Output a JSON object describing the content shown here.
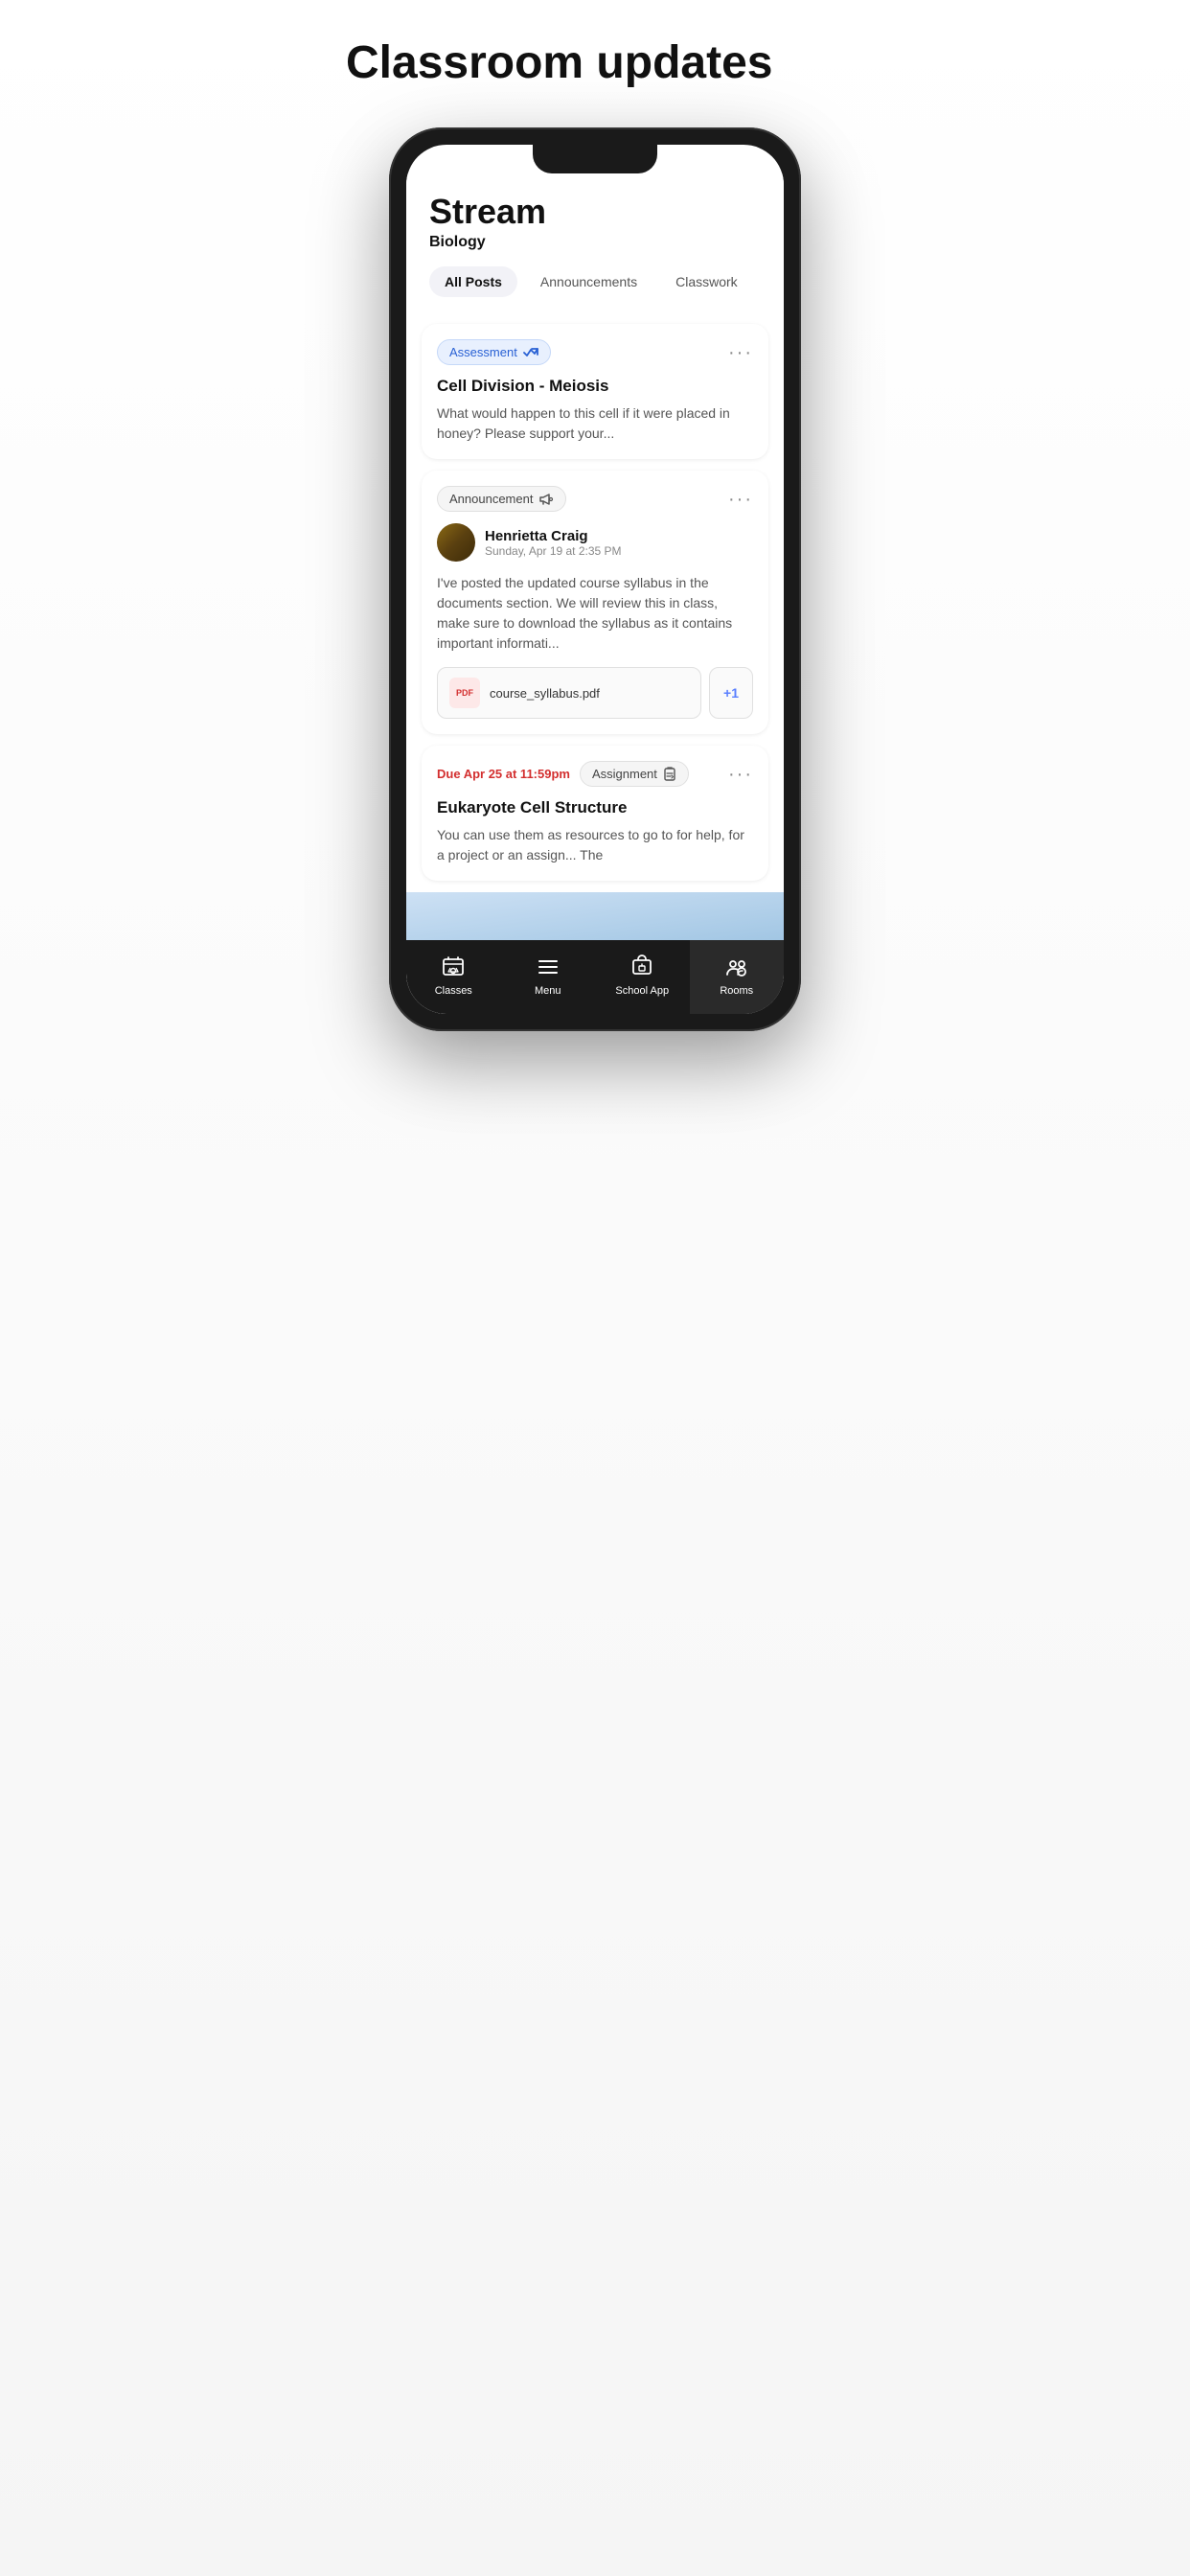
{
  "page": {
    "title": "Classroom updates"
  },
  "stream": {
    "title": "Stream",
    "subtitle": "Biology"
  },
  "tabs": [
    {
      "label": "All Posts",
      "active": true
    },
    {
      "label": "Announcements",
      "active": false
    },
    {
      "label": "Classwork",
      "active": false
    }
  ],
  "cards": [
    {
      "type": "assessment",
      "badge": "Assessment",
      "title": "Cell Division - Meiosis",
      "body": "What would happen to this cell if it were placed in honey? Please support your..."
    },
    {
      "type": "announcement",
      "badge": "Announcement",
      "author_name": "Henrietta Craig",
      "author_date": "Sunday, Apr 19 at 2:35 PM",
      "body": "I've posted the updated course syllabus in the documents section. We will review this in class, make sure to download the syllabus as it contains important informati...",
      "attachment": "course_syllabus.pdf",
      "attachment_extra": "+1"
    },
    {
      "type": "assignment",
      "due": "Due Apr 25 at 11:59pm",
      "badge": "Assignment",
      "title": "Eukaryote Cell Structure",
      "body": "You can use them as resources to go to for help, for a project or an assign... The"
    }
  ],
  "nav": {
    "items": [
      {
        "label": "Classes",
        "icon": "classes-icon",
        "active": false
      },
      {
        "label": "Menu",
        "icon": "menu-icon",
        "active": false
      },
      {
        "label": "School App",
        "icon": "schoolapp-icon",
        "active": false
      },
      {
        "label": "Rooms",
        "icon": "rooms-icon",
        "active": true
      }
    ]
  }
}
